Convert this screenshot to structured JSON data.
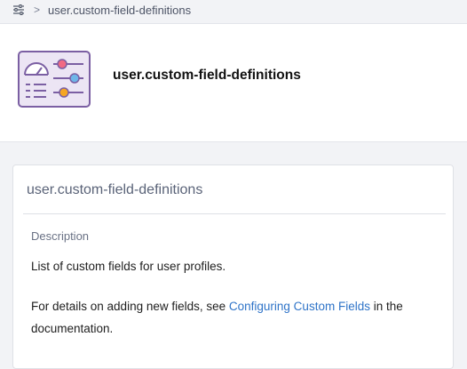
{
  "breadcrumb": {
    "icon": "sliders-icon",
    "separator": ">",
    "current": "user.custom-field-definitions"
  },
  "header": {
    "illustration": "settings-panel-icon",
    "title": "user.custom-field-definitions"
  },
  "card": {
    "title": "user.custom-field-definitions",
    "description_label": "Description",
    "description": "List of custom fields for user profiles.",
    "details_prefix": "For details on adding new fields, see ",
    "details_link": "Configuring Custom Fields",
    "details_suffix": " in the documentation."
  },
  "colors": {
    "link": "#2f74c8",
    "illustration_bg": "#ece5f4",
    "illustration_border": "#7b5fa3"
  }
}
